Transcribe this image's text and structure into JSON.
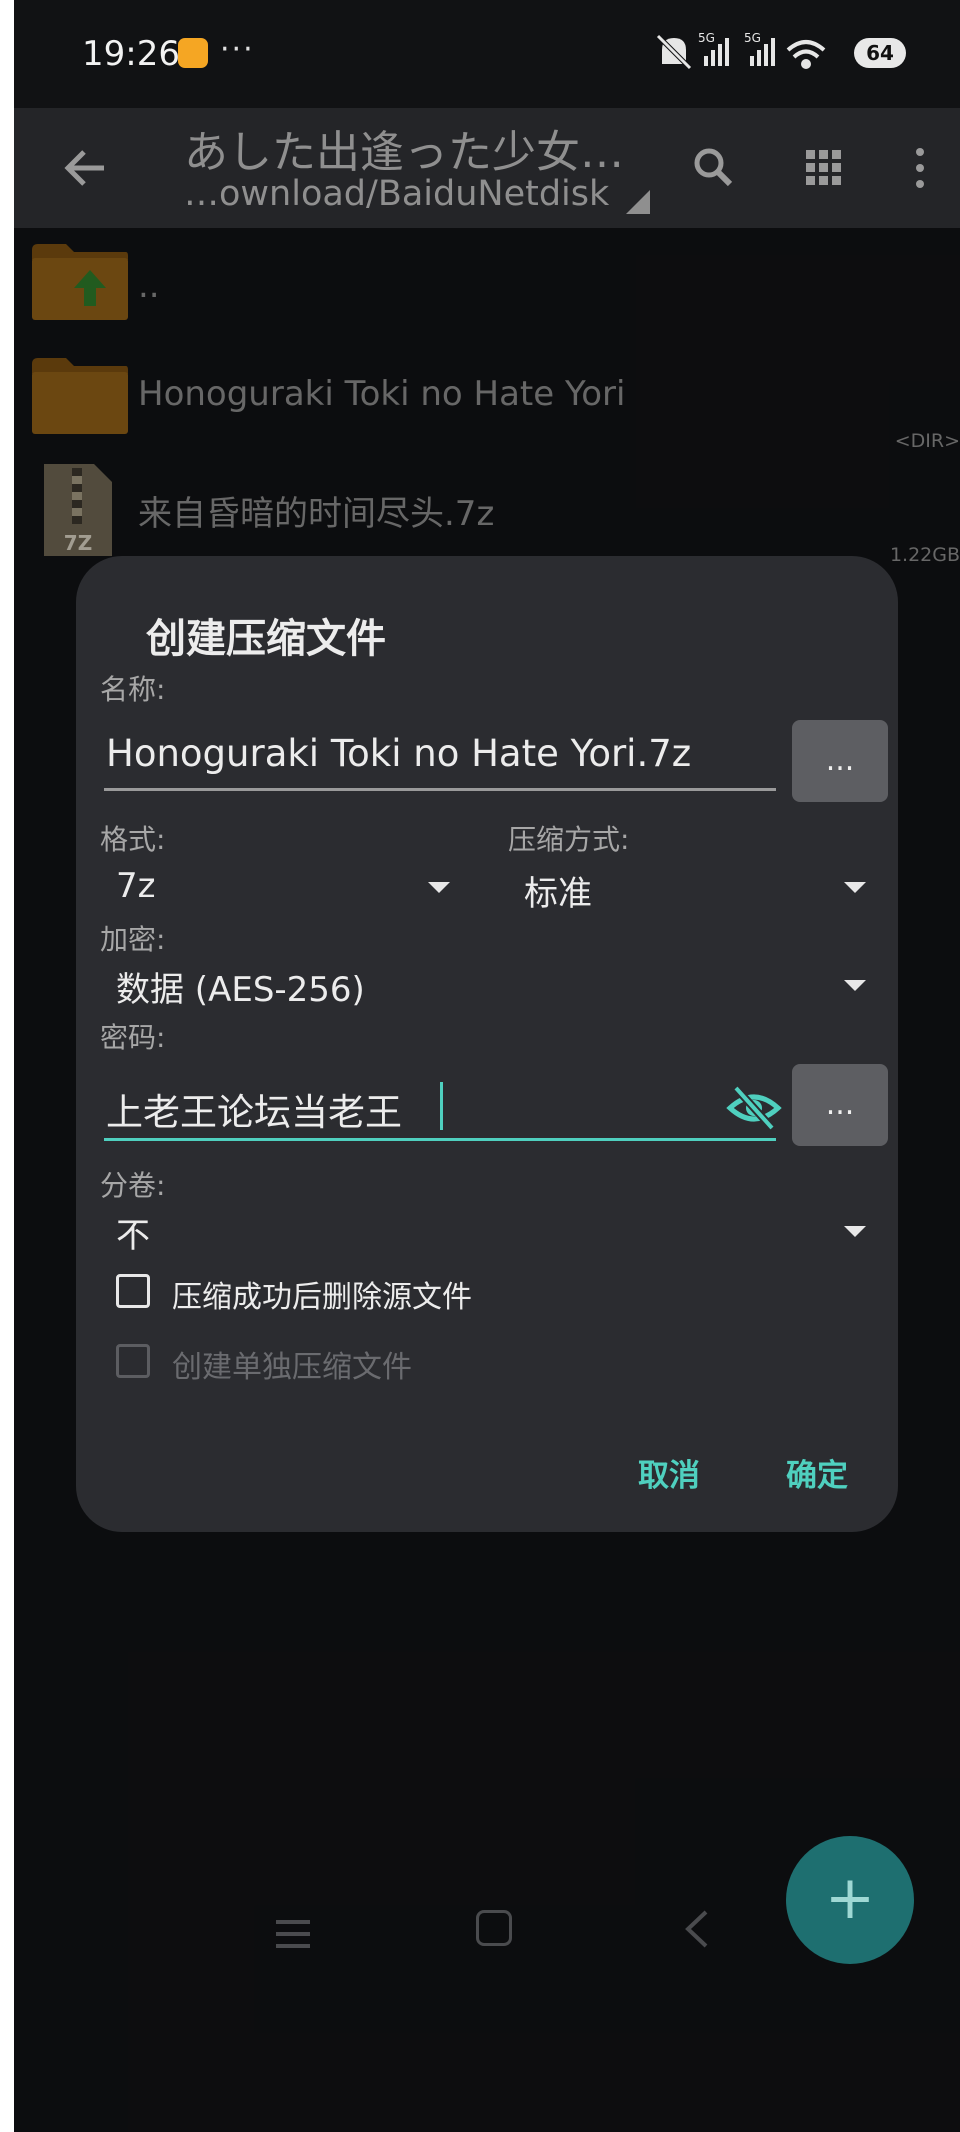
{
  "status_bar": {
    "time": "19:26",
    "more": "···",
    "battery": "64",
    "signal_label_1": "5G",
    "signal_label_2": "5G"
  },
  "app_bar": {
    "title": "あした出逢った少女…",
    "path": "…ownload/BaiduNetdisk",
    "icons": [
      "back-arrow-icon",
      "search-icon",
      "grid-view-icon",
      "overflow-menu-icon"
    ]
  },
  "files": [
    {
      "name": "..",
      "meta": "",
      "type": "parent-folder"
    },
    {
      "name": "Honoguraki Toki no Hate Yori",
      "meta": "<DIR>",
      "type": "folder"
    },
    {
      "name": "来自昏暗的时间尽头.7z",
      "meta": "1.22GB",
      "type": "archive",
      "badge": "7Z"
    }
  ],
  "dialog": {
    "title": "创建压缩文件",
    "name_label": "名称:",
    "name_value": "Honoguraki Toki no Hate Yori.7z",
    "browse_button": "...",
    "format_label": "格式:",
    "format_value": "7z",
    "method_label": "压缩方式:",
    "method_value": "标准",
    "encryption_label": "加密:",
    "encryption_value": "数据 (AES-256)",
    "password_label": "密码:",
    "password_value": "上老王论坛当老王",
    "password_options_button": "...",
    "split_label": "分卷:",
    "split_value": "不",
    "delete_source_label": "压缩成功后删除源文件",
    "delete_source_checked": false,
    "separate_archive_label": "创建单独压缩文件",
    "separate_archive_enabled": false,
    "cancel_label": "取消",
    "ok_label": "确定",
    "accent_color": "#4fd0bf"
  },
  "fab": {
    "label": "+"
  }
}
